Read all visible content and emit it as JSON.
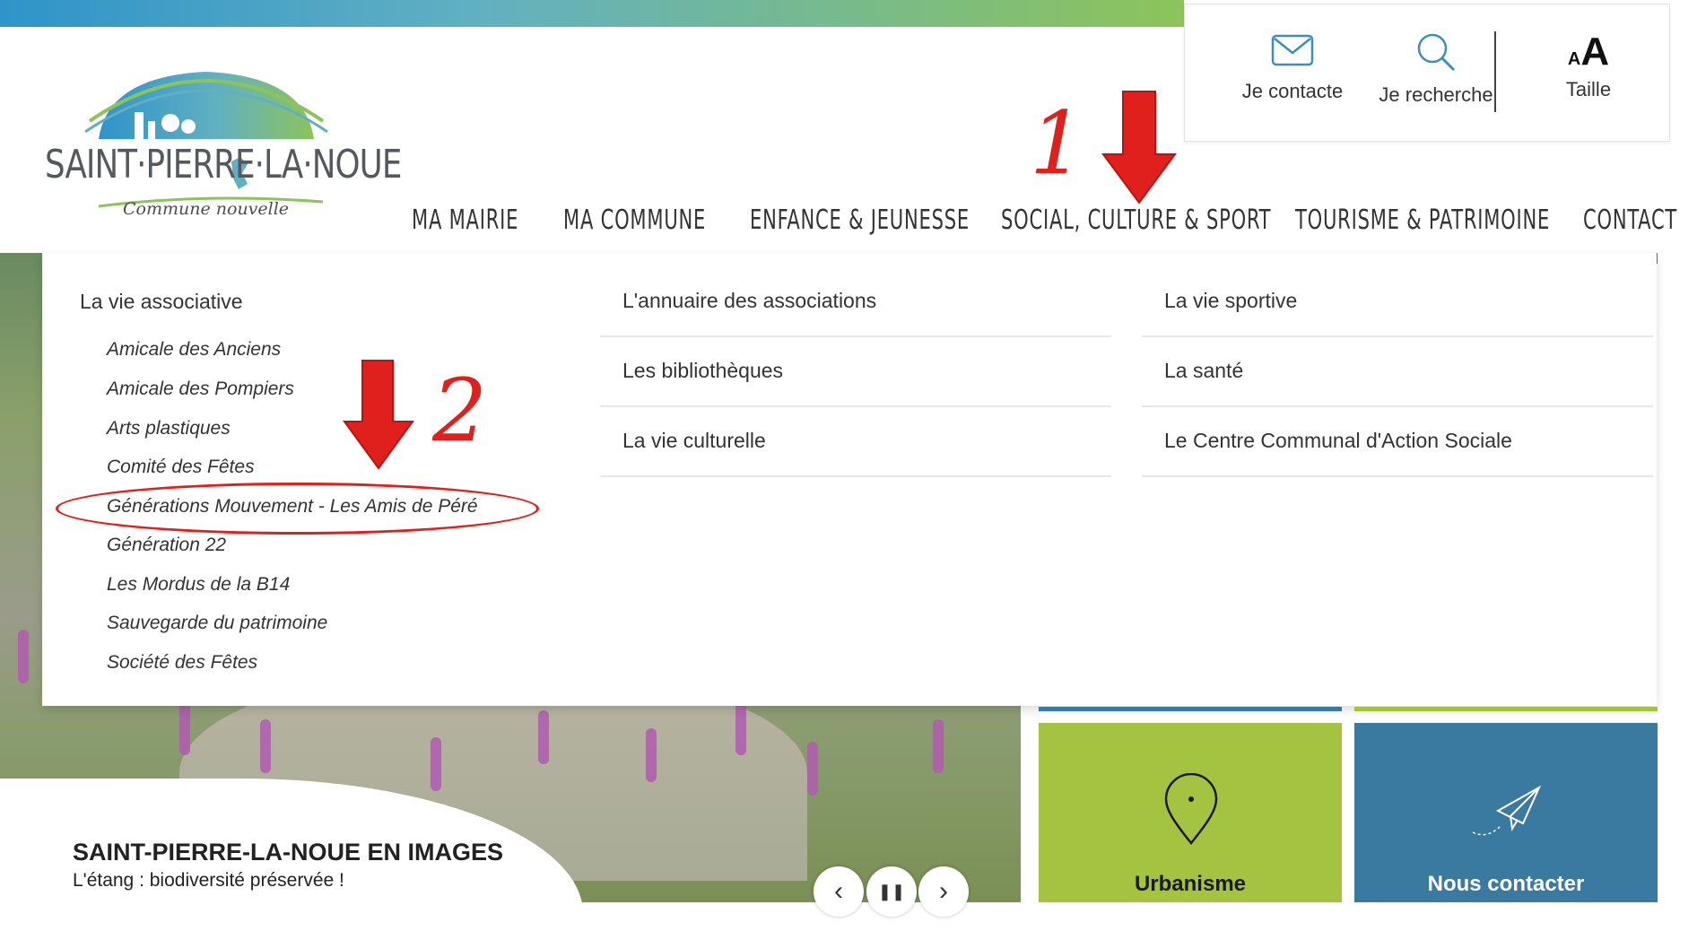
{
  "header": {
    "logo": {
      "name": "SAINT·PIERRE·LA·NOUE",
      "tagline": "Commune nouvelle"
    },
    "utility": {
      "contact": "Je contacte",
      "search": "Je recherche",
      "size": "Taille",
      "size_glyph_small": "A",
      "size_glyph_large": "A"
    }
  },
  "nav": {
    "items": [
      "MA MAIRIE",
      "MA COMMUNE",
      "ENFANCE & JEUNESSE",
      "SOCIAL, CULTURE & SPORT",
      "TOURISME & PATRIMOINE",
      "CONTACT"
    ]
  },
  "annotations": {
    "step1": "1",
    "step2": "2"
  },
  "dropdown": {
    "col1": {
      "heading": "La vie associative",
      "subitems": [
        "Amicale des Anciens",
        "Amicale des Pompiers",
        "Arts plastiques",
        "Comité des Fêtes",
        "Générations Mouvement - Les Amis de Péré",
        "Génération 22",
        "Les Mordus de la B14",
        "Sauvegarde du patrimoine",
        "Société des Fêtes"
      ]
    },
    "col2": [
      "L'annuaire des associations",
      "Les bibliothèques",
      "La vie culturelle"
    ],
    "col3": [
      "La vie sportive",
      "La santé",
      "Le Centre Communal d'Action Sociale"
    ]
  },
  "hero": {
    "title": "SAINT-PIERRE-LA-NOUE EN IMAGES",
    "subtitle": "L'étang : biodiversité préservée !",
    "controls": {
      "prev": "‹",
      "pause": "❚❚",
      "next": "›"
    }
  },
  "tiles": [
    {
      "label": "Urbanisme",
      "icon": "map-pin-icon",
      "color": "#a4c340"
    },
    {
      "label": "Nous contacter",
      "icon": "paper-plane-icon",
      "color": "#3b7aa0"
    }
  ],
  "colors": {
    "accent_red": "#e0201c",
    "green": "#a4c340",
    "blue": "#3b7aa0"
  }
}
